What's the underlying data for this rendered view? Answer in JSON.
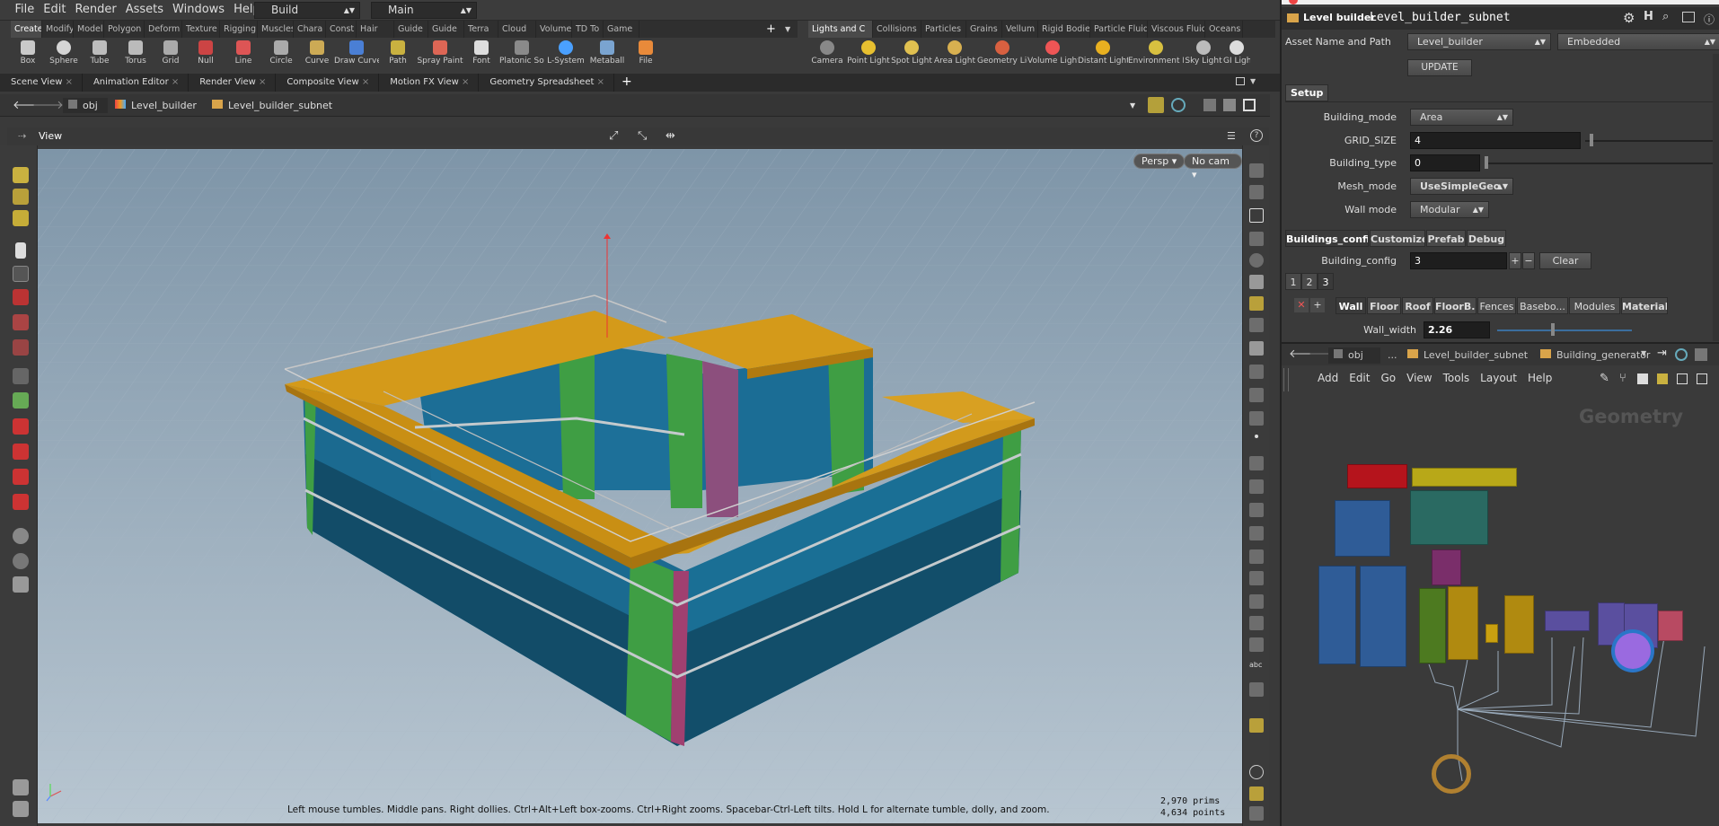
{
  "menu": [
    "File",
    "Edit",
    "Render",
    "Assets",
    "Windows",
    "Help"
  ],
  "desktop": {
    "build": "Build",
    "main": "Main"
  },
  "shelf_left_tabs": [
    "Create",
    "Modify",
    "Model",
    "Polygon",
    "Deform",
    "Texture",
    "Rigging",
    "Muscles",
    "Chara",
    "Const",
    "Hair",
    "Guide",
    "Guide",
    "Terra",
    "Cloud",
    "Volume",
    "TD To",
    "Game"
  ],
  "shelf_left_tools": [
    "Box",
    "Sphere",
    "Tube",
    "Torus",
    "Grid",
    "Null",
    "Line",
    "Circle",
    "Curve",
    "Draw Curve",
    "Path",
    "Spray Paint",
    "Font",
    "Platonic Solids",
    "L-System",
    "Metaball",
    "File"
  ],
  "shelf_right_tabs": [
    "Lights and C",
    "Collisions",
    "Particles",
    "Grains",
    "Vellum",
    "Rigid Bodies",
    "Particle Fluids",
    "Viscous Fluids",
    "Oceans"
  ],
  "shelf_right_tools": [
    "Camera",
    "Point Light",
    "Spot Light",
    "Area Light",
    "Geometry Light",
    "Volume Light",
    "Distant Light",
    "Environment Light",
    "Sky Light",
    "GI Ligh"
  ],
  "pane_tabs": [
    "Scene View",
    "Animation Editor",
    "Render View",
    "Composite View",
    "Motion FX View",
    "Geometry Spreadsheet"
  ],
  "path": {
    "root": "obj",
    "level1": "Level_builder",
    "level2": "Level_builder_subnet"
  },
  "view": {
    "label": "View",
    "persp": "Persp",
    "cam": "No cam",
    "help": "Left mouse tumbles. Middle pans. Right dollies. Ctrl+Alt+Left box-zooms. Ctrl+Right zooms. Spacebar-Ctrl-Left tilts. Hold L for alternate tumble, dolly, and zoom.",
    "prims": "2,970  prims",
    "points": "4,634 points"
  },
  "param": {
    "node_type": "Level builder",
    "node_name": "Level_builder_subnet",
    "asset_label": "Asset Name and Path",
    "asset_value": "Level_builder",
    "embedded": "Embedded",
    "update": "UPDATE",
    "setup_tab": "Setup",
    "building_mode_label": "Building_mode",
    "building_mode": "Area",
    "grid_size_label": "GRID_SIZE",
    "grid_size": "4",
    "building_type_label": "Building_type",
    "building_type": "0",
    "mesh_mode_label": "Mesh_mode",
    "mesh_mode": "UseSimpleGeo",
    "wall_mode_label": "Wall mode",
    "wall_mode": "Modular",
    "tabs2": [
      "Buildings_config",
      "Customize",
      "Prefab",
      "Debug"
    ],
    "building_config_label": "Building_config",
    "building_config": "3",
    "clear": "Clear",
    "num_tabs": [
      "1",
      "2",
      "3"
    ],
    "wall_tabs": [
      "Wall",
      "Floor",
      "Roof",
      "FloorB...",
      "Fences",
      "Basebo...",
      "Modules",
      "Material"
    ],
    "wall_width_label": "Wall_width",
    "wall_width": "2.26"
  },
  "network": {
    "obj": "obj",
    "dots": "...",
    "level2": "Level_builder_subnet",
    "level3": "Building_generator",
    "menu": [
      "Add",
      "Edit",
      "Go",
      "View",
      "Tools",
      "Layout",
      "Help"
    ],
    "context": "Geometry"
  }
}
